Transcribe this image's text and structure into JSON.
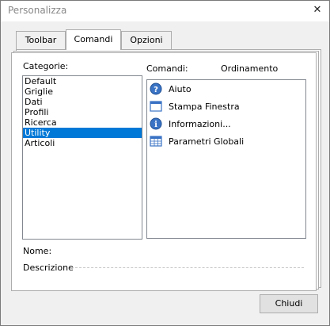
{
  "window": {
    "title": "Personalizza"
  },
  "tabs": [
    {
      "label": "Toolbar"
    },
    {
      "label": "Comandi",
      "active": true
    },
    {
      "label": "Opzioni"
    }
  ],
  "panel": {
    "categorie_label": "Categorie:",
    "comandi_label": "Comandi:",
    "ordinamento_label": "Ordinamento",
    "categories": [
      "Default",
      "Griglie",
      "Dati",
      "Profili",
      "Ricerca",
      "Utility",
      "Articoli"
    ],
    "selected_category": "Utility",
    "commands": [
      {
        "label": "Aiuto",
        "icon": "help-icon"
      },
      {
        "label": "Stampa Finestra",
        "icon": "window-icon"
      },
      {
        "label": "Informazioni...",
        "icon": "info-icon"
      },
      {
        "label": "Parametri Globali",
        "icon": "grid-icon"
      }
    ],
    "nome_label": "Nome:",
    "descrizione_label": "Descrizione"
  },
  "footer": {
    "close_label": "Chiudi"
  },
  "colors": {
    "selection": "#0078d7",
    "icon_blue": "#3a73c4"
  }
}
